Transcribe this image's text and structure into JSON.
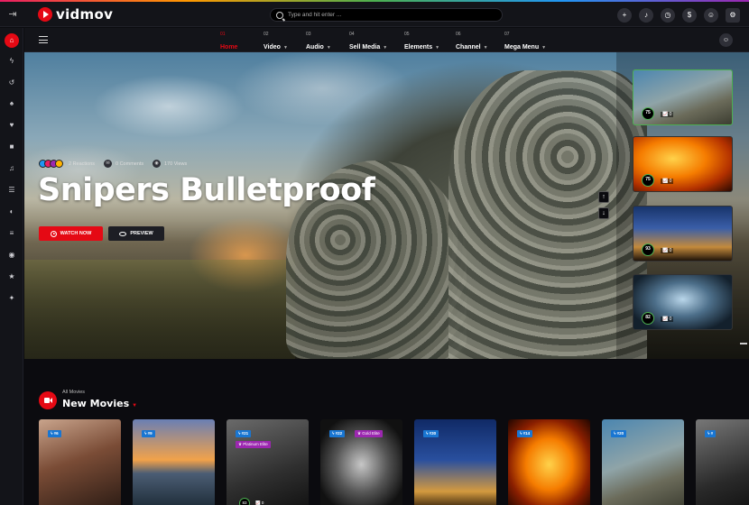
{
  "app": {
    "name": "vidmov"
  },
  "search": {
    "placeholder": "Type and hit enter ..."
  },
  "topbar": {
    "icons": [
      "plus-icon",
      "bell-icon",
      "clock-icon",
      "dollar-icon",
      "user-add-icon",
      "gear-icon"
    ]
  },
  "sidebar": {
    "items": [
      "home-icon",
      "bolt-icon",
      "history-icon",
      "bell-icon",
      "heart-icon",
      "video-icon",
      "music-icon",
      "list-icon",
      "media-icon",
      "layers-icon",
      "channel-icon",
      "star-icon",
      "thumbs-up-icon"
    ]
  },
  "nav": {
    "items": [
      {
        "num": "01",
        "label": "Home",
        "active": true
      },
      {
        "num": "02",
        "label": "Video"
      },
      {
        "num": "03",
        "label": "Audio"
      },
      {
        "num": "04",
        "label": "Sell Media"
      },
      {
        "num": "05",
        "label": "Elements"
      },
      {
        "num": "06",
        "label": "Channel"
      },
      {
        "num": "07",
        "label": "Mega Menu"
      }
    ]
  },
  "hero": {
    "reactions": "2 Reactions",
    "comments": "0 Comments",
    "views": "170 Views",
    "title": "Snipers Bulletproof",
    "watch_label": "WATCH NOW",
    "preview_label": "PREVIEW",
    "thumbs": [
      {
        "rating": "75",
        "stat": "0"
      },
      {
        "rating": "75",
        "stat": "0"
      },
      {
        "rating": "93",
        "stat": "0"
      },
      {
        "rating": "82",
        "stat": "0"
      }
    ]
  },
  "section": {
    "subtitle": "All Movies",
    "title": "New Movies",
    "movies": [
      {
        "badge": "#6"
      },
      {
        "badge": "#9"
      },
      {
        "badge": "#21",
        "elite": "Platinum Elite",
        "rating": "83",
        "stat": "0"
      },
      {
        "badge": "#22",
        "elite": "Gold Elite"
      },
      {
        "badge": "#30"
      },
      {
        "badge": "#14"
      },
      {
        "badge": "#20"
      },
      {
        "badge": "#"
      }
    ]
  },
  "colors": {
    "accent": "#e50914",
    "rating_ring": "#4caf50",
    "badge": "#1976d2",
    "elite": "#9c27b0"
  }
}
